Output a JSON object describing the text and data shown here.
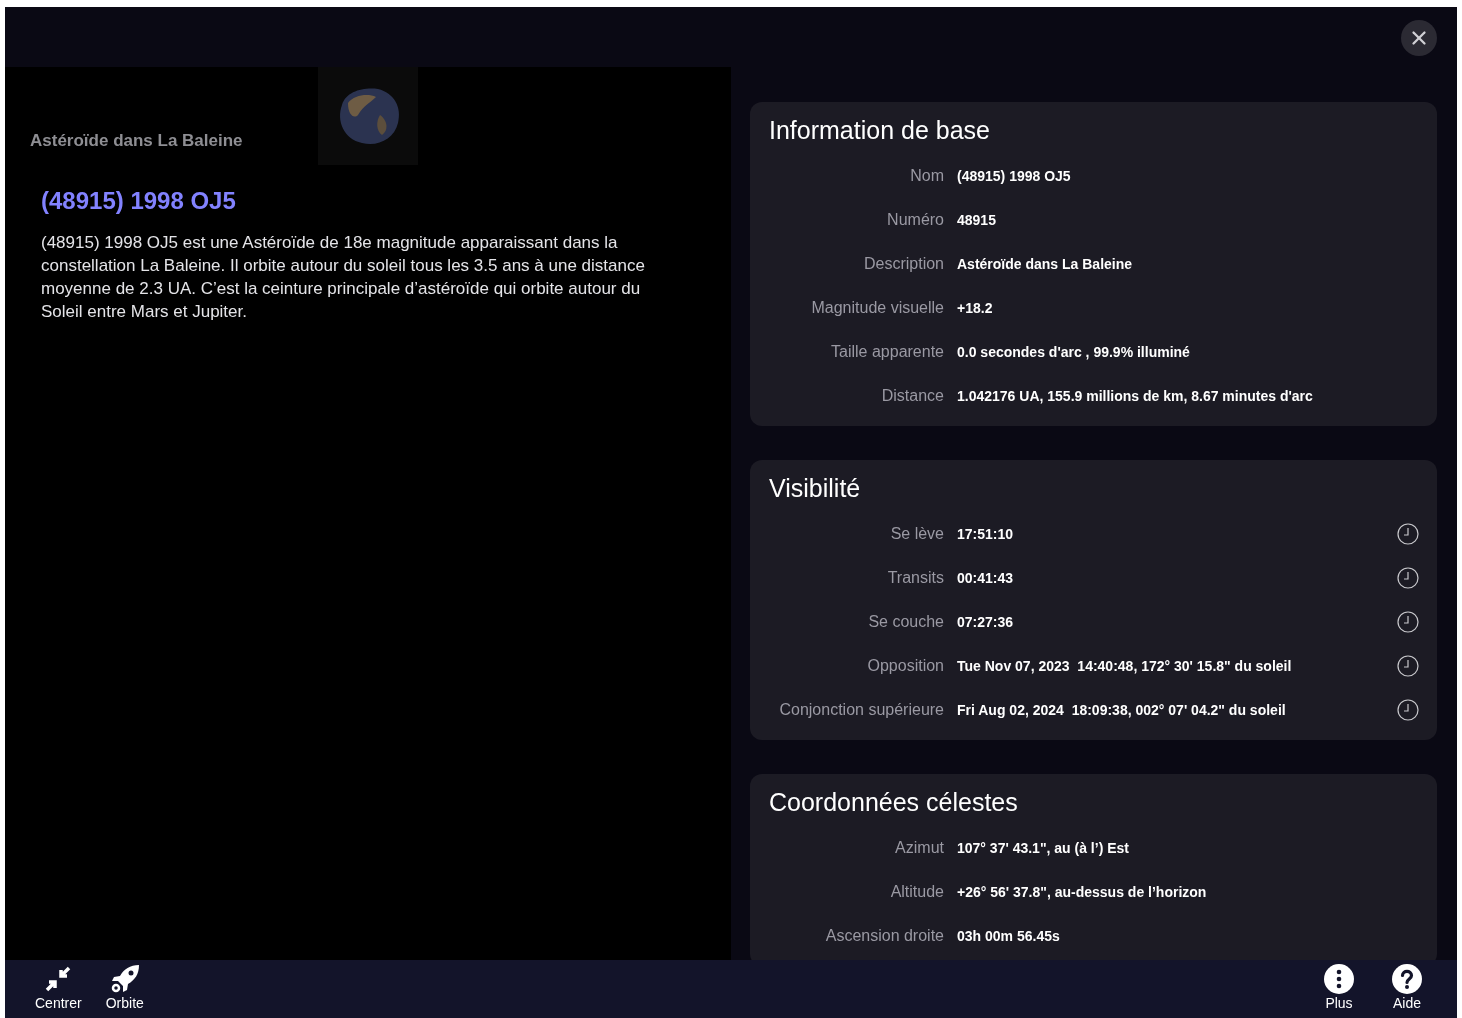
{
  "header": {
    "subtitle": "Astéroïde dans La Baleine",
    "title": "(48915) 1998 OJ5",
    "description": "(48915) 1998 OJ5 est une Astéroïde de 18e magnitude apparaissant dans la constellation La Baleine. Il orbite autour du soleil tous les 3.5 ans à une distance moyenne de 2.3 UA. C’est la ceinture principale d’astéroïde qui orbite autour du Soleil entre Mars et Jupiter."
  },
  "sections": [
    {
      "title": "Information de base",
      "clock": false,
      "rows": [
        {
          "label": "Nom",
          "value": "(48915) 1998 OJ5"
        },
        {
          "label": "Numéro",
          "value": "48915"
        },
        {
          "label": "Description",
          "value": "Astéroïde dans La Baleine"
        },
        {
          "label": "Magnitude visuelle",
          "value": "+18.2"
        },
        {
          "label": "Taille apparente",
          "value": "0.0 secondes d'arc , 99.9% illuminé"
        },
        {
          "label": "Distance",
          "value": "1.042176 UA, 155.9 millions de km, 8.67 minutes d'arc"
        }
      ]
    },
    {
      "title": "Visibilité",
      "clock": true,
      "rows": [
        {
          "label": "Se lève",
          "value": "17:51:10"
        },
        {
          "label": "Transits",
          "value": "00:41:43"
        },
        {
          "label": "Se couche",
          "value": "07:27:36"
        },
        {
          "label": "Opposition",
          "value": "Tue Nov 07, 2023  14:40:48, 172° 30' 15.8\" du soleil"
        },
        {
          "label": "Conjonction supérieure",
          "value": "Fri Aug 02, 2024  18:09:38, 002° 07' 04.2\" du soleil"
        }
      ]
    },
    {
      "title": "Coordonnées célestes",
      "clock": false,
      "rows": [
        {
          "label": "Azimut",
          "value": "107° 37' 43.1\", au (à l’) Est"
        },
        {
          "label": "Altitude",
          "value": "+26° 56' 37.8\", au-dessus de l’horizon"
        },
        {
          "label": "Ascension droite",
          "value": "03h 00m 56.45s"
        }
      ]
    }
  ],
  "toolbar": {
    "left": [
      {
        "kind": "center",
        "label": "Centrer"
      },
      {
        "kind": "orbit",
        "label": "Orbite"
      }
    ],
    "right": [
      {
        "kind": "more",
        "label": "Plus"
      },
      {
        "kind": "help",
        "label": "Aide"
      }
    ]
  }
}
